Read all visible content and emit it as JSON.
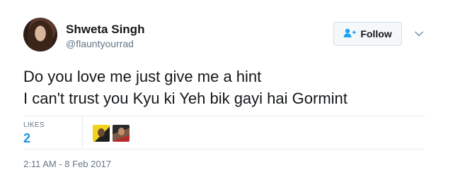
{
  "author": {
    "name": "Shweta Singh",
    "handle": "@flauntyourrad"
  },
  "follow": {
    "label": "Follow"
  },
  "tweet": {
    "lines": [
      "Do you love me just give me a hint",
      "I can't trust you Kyu ki Yeh bik gayi hai Gormint"
    ]
  },
  "stats": {
    "likes_label": "LIKES",
    "likes_count": "2"
  },
  "timestamp": "2:11 AM - 8 Feb 2017",
  "colors": {
    "link_blue": "#1b95e0",
    "muted_gray": "#657786",
    "text": "#14171a"
  },
  "icons": {
    "follow": "add-user-icon",
    "menu": "chevron-down-icon"
  }
}
